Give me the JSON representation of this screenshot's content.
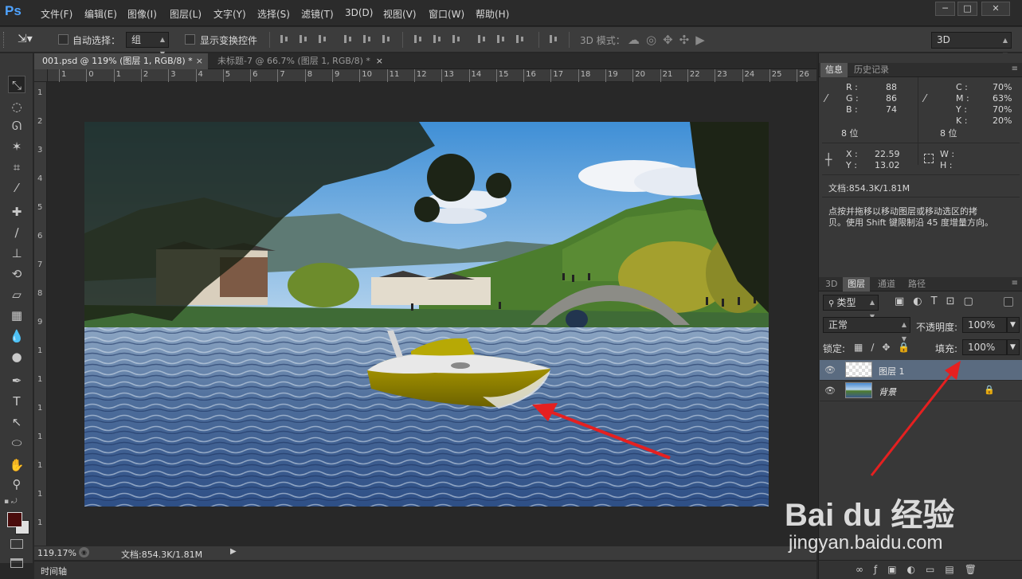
{
  "app": {
    "logo": "Ps",
    "menus": [
      "文件(F)",
      "编辑(E)",
      "图像(I)",
      "图层(L)",
      "文字(Y)",
      "选择(S)",
      "滤镜(T)",
      "3D(D)",
      "视图(V)",
      "窗口(W)",
      "帮助(H)"
    ],
    "window_buttons": [
      "─",
      "□",
      "✕"
    ]
  },
  "options": {
    "auto_select_label": "自动选择：",
    "auto_select_value": "组",
    "show_transform_label": "显示变换控件",
    "mode_3d_label": "3D 模式：",
    "workspace_value": "3D"
  },
  "tabs": [
    {
      "label": "001.psd @ 119% (图层 1, RGB/8) *",
      "close": "×"
    },
    {
      "label": "未标题-7 @ 66.7% (图层 1, RGB/8) *",
      "close": "×"
    }
  ],
  "ruler_top_labels": [
    "1",
    "0",
    "1",
    "2",
    "3",
    "4",
    "5",
    "6",
    "7",
    "8",
    "9",
    "10",
    "11",
    "12",
    "13",
    "14",
    "15",
    "16",
    "17",
    "18",
    "19",
    "20",
    "21",
    "22",
    "23",
    "24",
    "25",
    "26"
  ],
  "ruler_left_labels": [
    "1",
    "2",
    "3",
    "4",
    "5",
    "6",
    "7",
    "8",
    "9",
    "1",
    "1",
    "1",
    "1",
    "1",
    "1",
    "1"
  ],
  "status": {
    "zoom": "119.17%",
    "doc": "文档:854.3K/1.81M",
    "timeline": "时间轴"
  },
  "info_panel": {
    "tabs": [
      "信息",
      "历史记录"
    ],
    "rgb": {
      "R": "88",
      "G": "86",
      "B": "74"
    },
    "cmyk": {
      "C": "70%",
      "M": "63%",
      "Y": "70%",
      "K": "20%"
    },
    "bits_left": "8 位",
    "bits_right": "8 位",
    "x_label": "X :",
    "x_value": "22.59",
    "y_label": "Y :",
    "y_value": "13.02",
    "w_label": "W :",
    "h_label": "H :",
    "doc": "文档:854.3K/1.81M",
    "hint_line1": "点按并拖移以移动图层或移动选区的拷",
    "hint_line2": "贝。使用 Shift 键限制沿 45 度增量方向。"
  },
  "layers_panel": {
    "tabs": [
      "3D",
      "图层",
      "通道",
      "路径"
    ],
    "filter_kind": "类型",
    "blend_mode": "正常",
    "opacity_label": "不透明度:",
    "opacity_value": "100%",
    "lock_label": "锁定:",
    "fill_label": "填充:",
    "fill_value": "100%",
    "layers": [
      {
        "name": "图层 1",
        "selected": true
      },
      {
        "name": "背景",
        "selected": false,
        "locked": true
      }
    ]
  },
  "watermark": {
    "brand": "Bai du 经验",
    "url": "jingyan.baidu.com"
  },
  "colors": {
    "accent_selected_layer": "#5a6b80",
    "foreground_swatch": "#4a0c0c",
    "arrow": "#e52020"
  }
}
